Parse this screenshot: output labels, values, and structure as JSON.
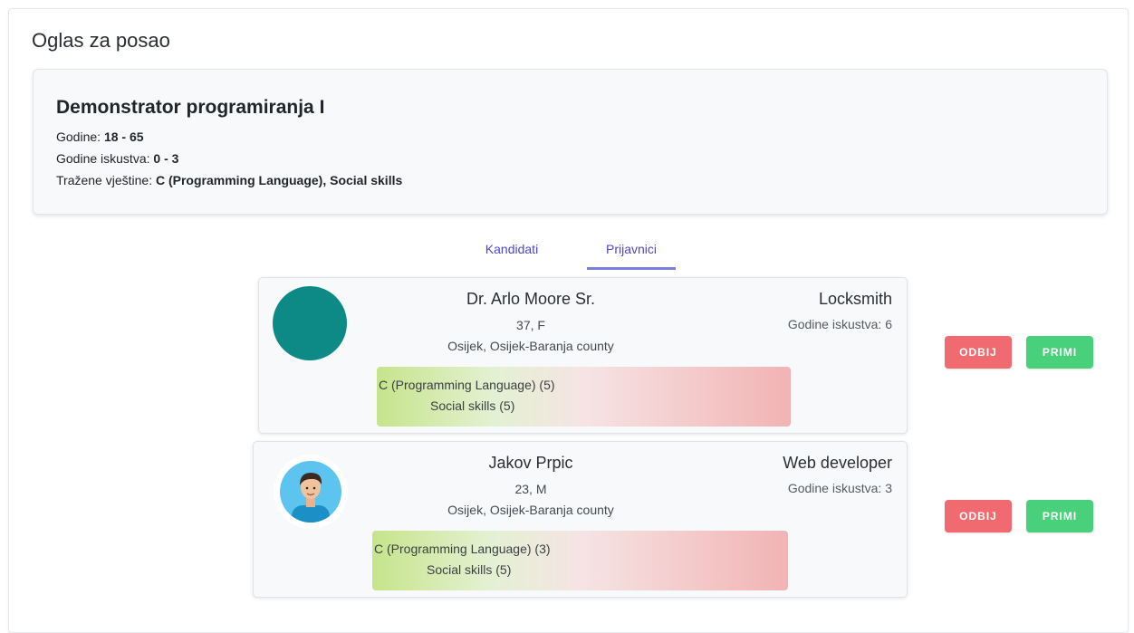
{
  "page": {
    "title": "Oglas za posao"
  },
  "job": {
    "title": "Demonstrator programiranja I",
    "age_label": "Godine:",
    "age_value": "18 - 65",
    "exp_label": "Godine iskustva:",
    "exp_value": "0 - 3",
    "skills_label": "Tražene vještine:",
    "skills_value": "C (Programming Language), Social skills"
  },
  "tabs": [
    {
      "label": "Kandidati",
      "active": false
    },
    {
      "label": "Prijavnici",
      "active": true
    }
  ],
  "applicants": [
    {
      "name": "Dr. Arlo Moore Sr.",
      "age_sex": "37, F",
      "location": "Osijek, Osijek-Baranja county",
      "role": "Locksmith",
      "experience": "Godine iskustva: 6",
      "skills": [
        "C (Programming Language) (5)",
        "Social skills (5)"
      ],
      "avatar_color": "#0d8a85",
      "reject_label": "ODBIJ",
      "accept_label": "PRIMI"
    },
    {
      "name": "Jakov Prpic",
      "age_sex": "23, M",
      "location": "Osijek, Osijek-Baranja county",
      "role": "Web developer",
      "experience": "Godine iskustva: 3",
      "skills": [
        "C (Programming Language) (3)",
        "Social skills (5)"
      ],
      "avatar_color": "#5cc4ee",
      "reject_label": "ODBIJ",
      "accept_label": "PRIMI"
    }
  ]
}
